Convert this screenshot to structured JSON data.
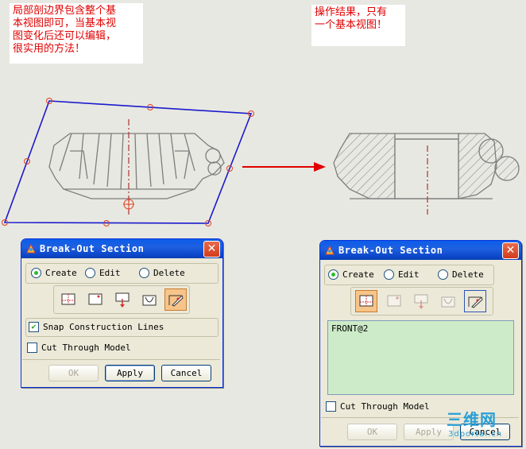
{
  "annotations": {
    "left": "局部剖边界包含整个基\n本视图即可，当基本视\n图变化后还可以编辑，\n很实用的方法！",
    "right": "操作结果，只有\n一个基本视图！"
  },
  "colors": {
    "accent_red": "#e00000",
    "boundary_blue": "#1a1acc",
    "drawing_gray": "#7d7d7d",
    "list_green": "#cdebc8",
    "titlebar_blue": "#0b46c8"
  },
  "dialog_left": {
    "title": "Break-Out Section",
    "close_label": "✕",
    "mode_options": [
      {
        "label": "Create",
        "selected": true
      },
      {
        "label": "Edit",
        "selected": false
      },
      {
        "label": "Delete",
        "selected": false
      }
    ],
    "step_icons": [
      "select-view-icon",
      "base-point-icon",
      "extrude-vector-icon",
      "select-curves-icon",
      "modify-boundary-icon"
    ],
    "snap_label": "Snap Construction Lines",
    "snap_checked": true,
    "cut_label": "Cut Through Model",
    "cut_checked": false,
    "ok_label": "OK",
    "apply_label": "Apply",
    "cancel_label": "Cancel"
  },
  "dialog_right": {
    "title": "Break-Out Section",
    "close_label": "✕",
    "mode_options": [
      {
        "label": "Create",
        "selected": true
      },
      {
        "label": "Edit",
        "selected": false
      },
      {
        "label": "Delete",
        "selected": false
      }
    ],
    "step_icons": [
      "select-view-icon",
      "base-point-icon",
      "extrude-vector-icon",
      "select-curves-icon",
      "modify-boundary-icon"
    ],
    "view_list": [
      "FRONT@2"
    ],
    "cut_label": "Cut Through Model",
    "cut_checked": false,
    "ok_label": "OK",
    "apply_label": "Apply",
    "cancel_label": "Cancel"
  },
  "watermark": {
    "text": "三维网",
    "sub": "3dportal.cn"
  }
}
